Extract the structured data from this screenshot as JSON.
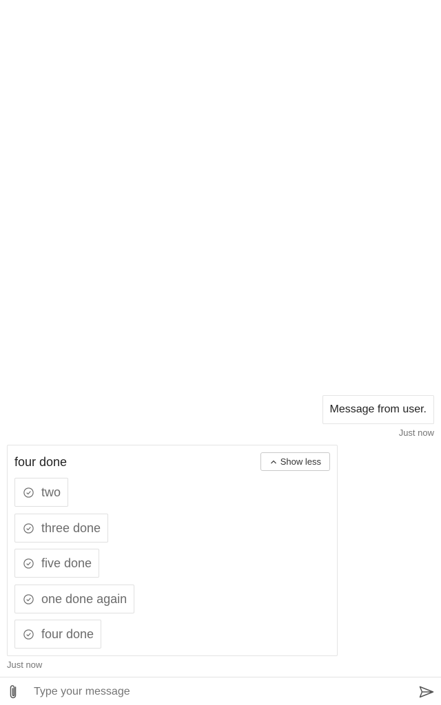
{
  "user_message": {
    "text": "Message from user.",
    "time": "Just now"
  },
  "bot_card": {
    "title": "four done",
    "toggle_label": "Show less",
    "options": [
      {
        "label": "two"
      },
      {
        "label": "three done"
      },
      {
        "label": "five done"
      },
      {
        "label": "one done again"
      },
      {
        "label": "four done"
      }
    ],
    "time": "Just now"
  },
  "composer": {
    "placeholder": "Type your message",
    "value": ""
  },
  "icons": {
    "attach": "paperclip-icon",
    "send": "send-icon",
    "toggle": "chevron-up-icon",
    "option": "check-circle-icon"
  }
}
